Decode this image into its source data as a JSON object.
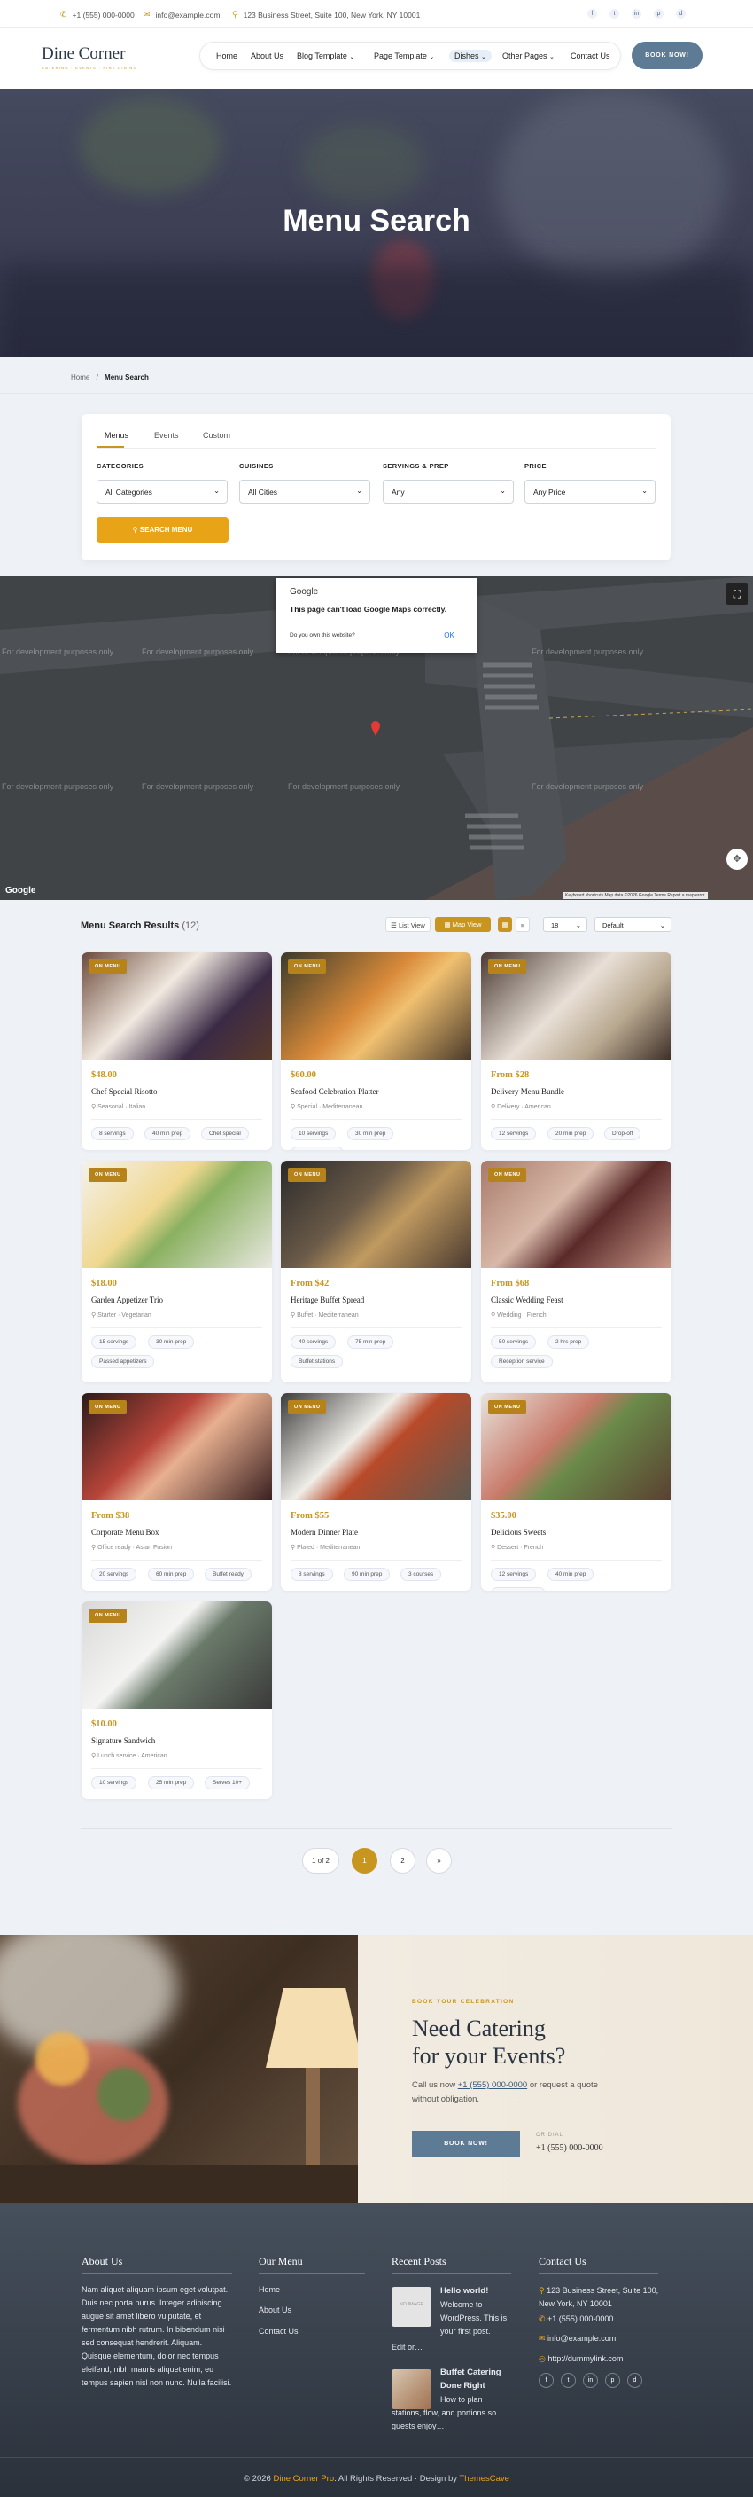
{
  "topbar": {
    "phone": "+1 (555) 000-0000",
    "email": "info@example.com",
    "address": "123 Business Street, Suite 100, New York, NY 10001",
    "social": [
      "f",
      "t",
      "in",
      "p",
      "d"
    ]
  },
  "header": {
    "logo": "Dine Corner",
    "logo_tag": "CATERING · EVENTS · FINE DINING",
    "nav": [
      "Home",
      "About Us",
      "Blog Template",
      "Page Template",
      "Dishes",
      "Other Pages",
      "Contact Us"
    ],
    "cta": "BOOK NOW!"
  },
  "hero": {
    "title": "Menu Search"
  },
  "breadcrumb": {
    "home": "Home",
    "sep": "/",
    "current": "Menu Search"
  },
  "search": {
    "tabs": [
      "Menus",
      "Events",
      "Custom"
    ],
    "filters": [
      {
        "label": "CATEGORIES",
        "value": "All Categories"
      },
      {
        "label": "CUISINES",
        "value": "All Cities"
      },
      {
        "label": "SERVINGS & PREP",
        "value": "Any"
      },
      {
        "label": "PRICE",
        "value": "Any Price"
      }
    ],
    "button": "SEARCH MENU"
  },
  "map": {
    "dialog_brand": "Google",
    "dialog_msg": "This page can't load Google Maps correctly.",
    "dialog_q": "Do you own this website?",
    "dialog_ok": "OK",
    "dev": "For development purposes only",
    "google": "Google",
    "attrib": "Keyboard shortcuts  Map data ©2026 Google  Terms  Report a map error"
  },
  "results": {
    "title": "Menu Search Results",
    "count": "(12)",
    "list_view": "List View",
    "map_view": "Map View",
    "per_page": "18",
    "sort": "Default"
  },
  "cards": [
    {
      "badge": "ON MENU",
      "price": "$48.00",
      "name": "Chef Special Risotto",
      "meta": "Seasonal · Italian",
      "chips": [
        "8 servings",
        "40 min prep",
        "Chef special"
      ]
    },
    {
      "badge": "ON MENU",
      "price": "$60.00",
      "name": "Seafood Celebration Platter",
      "meta": "Special · Mediterranean",
      "chips": [
        "10 servings",
        "30 min prep",
        "Sharing platter"
      ]
    },
    {
      "badge": "ON MENU",
      "price": "From $28",
      "name": "Delivery Menu Bundle",
      "meta": "Delivery · American",
      "chips": [
        "12 servings",
        "20 min prep",
        "Drop-off"
      ]
    },
    {
      "badge": "ON MENU",
      "price": "$18.00",
      "name": "Garden Appetizer Trio",
      "meta": "Starter · Vegetarian",
      "chips": [
        "15 servings",
        "30 min prep",
        "Passed appetizers"
      ]
    },
    {
      "badge": "ON MENU",
      "price": "From $42",
      "name": "Heritage Buffet Spread",
      "meta": "Buffet · Mediterranean",
      "chips": [
        "40 servings",
        "75 min prep",
        "Buffet stations"
      ]
    },
    {
      "badge": "ON MENU",
      "price": "From $68",
      "name": "Classic Wedding Feast",
      "meta": "Wedding · French",
      "chips": [
        "50 servings",
        "2 hrs prep",
        "Reception service"
      ]
    },
    {
      "badge": "ON MENU",
      "price": "From $38",
      "name": "Corporate Menu Box",
      "meta": "Office ready · Asian Fusion",
      "chips": [
        "20 servings",
        "60 min prep",
        "Buffet ready"
      ]
    },
    {
      "badge": "ON MENU",
      "price": "From $55",
      "name": "Modern Dinner Plate",
      "meta": "Plated · Mediterranean",
      "chips": [
        "8 servings",
        "90 min prep",
        "3 courses"
      ]
    },
    {
      "badge": "ON MENU",
      "price": "$35.00",
      "name": "Delicious Sweets",
      "meta": "Dessert · French",
      "chips": [
        "12 servings",
        "40 min prep",
        "Dessert course"
      ]
    },
    {
      "badge": "ON MENU",
      "price": "$10.00",
      "name": "Signature Sandwich",
      "meta": "Lunch service · American",
      "chips": [
        "10 servings",
        "25 min prep",
        "Serves 10+"
      ]
    }
  ],
  "pagination": {
    "info": "1 of 2",
    "pages": [
      "1",
      "2"
    ],
    "next": "»"
  },
  "cta": {
    "kicker": "BOOK YOUR CELEBRATION",
    "title_l1": "Need Catering",
    "title_l2": "for your Events?",
    "text_a": "Call us now ",
    "phone": "+1 (555) 000-0000",
    "text_b": " or request a quote without obligation.",
    "button": "BOOK NOW!",
    "or_dial": "OR DIAL",
    "dial": "+1 (555) 000-0000"
  },
  "footer": {
    "about_title": "About Us",
    "about_text": "Nam aliquet aliquam ipsum eget volutpat. Duis nec porta purus. Integer adipiscing augue sit amet libero vulputate, et fermentum nibh rutrum. In bibendum nisi sed consequat hendrerit. Aliquam. Quisque elementum, dolor nec tempus eleifend, nibh mauris aliquet enim, eu tempus sapien nisl non nunc. Nulla facilisi.",
    "menu_title": "Our Menu",
    "menu": [
      "Home",
      "About Us",
      "Contact Us"
    ],
    "posts_title": "Recent Posts",
    "post1_title": "Hello world!",
    "post1_text": "Welcome to WordPress. This is your first post.",
    "post1_more": "Edit or…",
    "post1_thumb": "NO IMAGE",
    "post2_title": "Buffet Catering Done Right",
    "post2_text": "How to plan stations, flow, and portions so guests enjoy…",
    "contact_title": "Contact Us",
    "address": "123 Business Street, Suite 100, New York, NY 10001",
    "phone": "+1 (555) 000-0000",
    "email": "info@example.com",
    "site": "http://dummylink.com",
    "copyright_a": "© 2026 ",
    "brand": "Dine Corner Pro",
    "copyright_b": ". All Rights Reserved  ·  Design by ",
    "designer": "ThemesCave"
  },
  "colors": {
    "accent": "#c8961e",
    "button_gold": "#e8a317",
    "header_btn": "#5d7b95",
    "footer": "#2f3640"
  }
}
